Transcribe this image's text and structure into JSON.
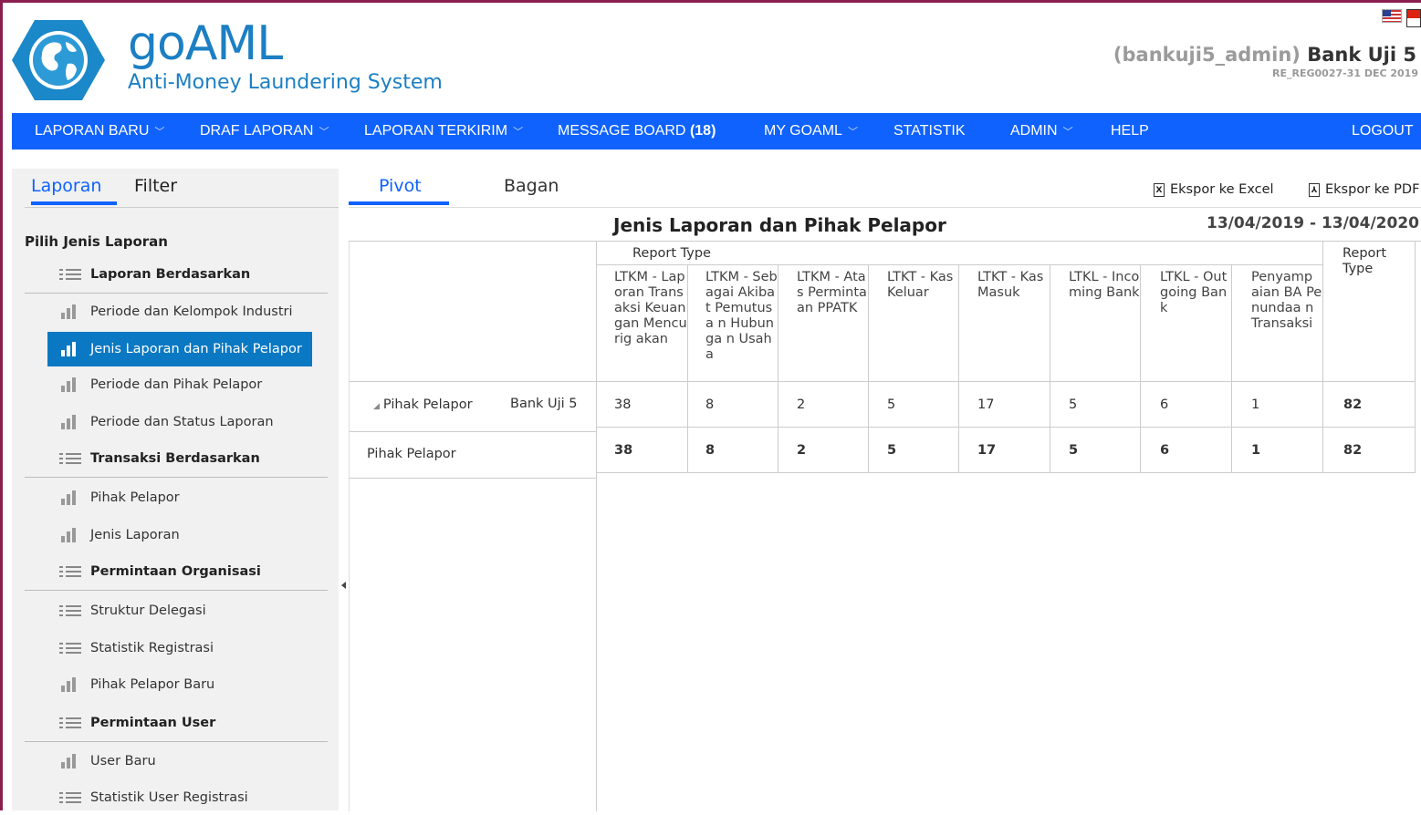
{
  "brand": {
    "name": "goAML",
    "subtitle": "Anti-Money Laundering System",
    "user_name": "(bankuji5_admin)",
    "bank_name": "Bank Uji 5",
    "period": "RE_REG0027-31 DEC 2019"
  },
  "nav": [
    {
      "label": "LAPORAN BARU",
      "chevron": true,
      "badge": ""
    },
    {
      "label": "DRAF LAPORAN",
      "chevron": true,
      "badge": ""
    },
    {
      "label": "LAPORAN TERKIRIM",
      "chevron": true,
      "badge": ""
    },
    {
      "label": "MESSAGE BOARD",
      "chevron": false,
      "badge": "(18)"
    },
    {
      "label": "MY GOAML",
      "chevron": true,
      "badge": ""
    },
    {
      "label": "STATISTIK",
      "chevron": false,
      "badge": ""
    },
    {
      "label": "ADMIN",
      "chevron": true,
      "badge": ""
    },
    {
      "label": "HELP",
      "chevron": false,
      "badge": ""
    },
    {
      "label": "LOGOUT",
      "chevron": false,
      "badge": ""
    }
  ],
  "left_tabs": {
    "laporan": "Laporan",
    "filter": "Filter"
  },
  "section_title": "Pilih Jenis Laporan",
  "menu": [
    {
      "label": "Laporan Berdasarkan",
      "icon": "list-icon",
      "group": true
    },
    {
      "label": "Periode dan Kelompok Industri",
      "icon": "bar-chart-icon",
      "group": false
    },
    {
      "label": "Jenis Laporan dan Pihak Pelapor",
      "icon": "bar-chart-icon",
      "group": false,
      "selected": true
    },
    {
      "label": "Periode dan Pihak Pelapor",
      "icon": "bar-chart-icon",
      "group": false
    },
    {
      "label": "Periode dan Status Laporan",
      "icon": "bar-chart-icon",
      "group": false
    },
    {
      "label": "Transaksi Berdasarkan",
      "icon": "list-icon",
      "group": true
    },
    {
      "label": "Pihak Pelapor",
      "icon": "bar-chart-icon",
      "group": false
    },
    {
      "label": "Jenis Laporan",
      "icon": "bar-chart-icon",
      "group": false
    },
    {
      "label": "Permintaan Organisasi",
      "icon": "list-icon",
      "group": true
    },
    {
      "label": "Struktur Delegasi",
      "icon": "list-icon",
      "group": false
    },
    {
      "label": "Statistik Registrasi",
      "icon": "list-icon",
      "group": false
    },
    {
      "label": "Pihak Pelapor Baru",
      "icon": "bar-chart-icon",
      "group": false
    },
    {
      "label": "Permintaan User",
      "icon": "list-icon",
      "group": true
    },
    {
      "label": "User Baru",
      "icon": "bar-chart-icon",
      "group": false
    },
    {
      "label": "Statistik User Registrasi",
      "icon": "list-icon",
      "group": false
    }
  ],
  "right_tabs": {
    "pivot": "Pivot",
    "bagan": "Bagan"
  },
  "export": {
    "excel": "Ekspor ke Excel",
    "pdf": "Ekspor ke PDF"
  },
  "report": {
    "title": "Jenis Laporan dan Pihak Pelapor",
    "date_range": "13/04/2019 - 13/04/2020"
  },
  "pivot": {
    "column_group": "Report Type",
    "total_header": "Report Type",
    "columns": [
      "LTKM - Laporan Transaksi Keuangan Mencurig akan",
      "LTKM - Sebagai Akibat Pemutusa n Hubunga n Usaha",
      "LTKM - Atas Perminta an PPATK",
      "LTKT - Kas Keluar",
      "LTKT - Kas Masuk",
      "LTKL - Incoming Bank",
      "LTKL - Outgoing Bank",
      "Penyamp aian BA Penundaa n Transaksi"
    ],
    "row_group_label": "Pihak Pelapor",
    "row_member": "Bank Uji 5",
    "row_values": [
      "38",
      "8",
      "2",
      "5",
      "17",
      "5",
      "6",
      "1"
    ],
    "row_total": "82",
    "grand_label": "Pihak Pelapor",
    "grand_values": [
      "38",
      "8",
      "2",
      "5",
      "17",
      "5",
      "6",
      "1"
    ],
    "grand_total": "82"
  }
}
